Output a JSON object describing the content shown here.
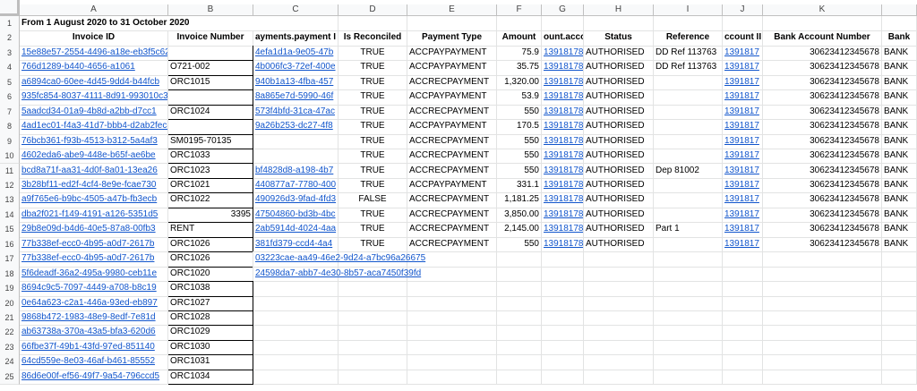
{
  "column_letters": [
    "A",
    "B",
    "C",
    "D",
    "E",
    "F",
    "G",
    "H",
    "I",
    "J",
    "K",
    ""
  ],
  "title": "From 1 August 2020 to 31 October 2020",
  "headers": [
    "Invoice ID",
    "Invoice Number",
    "ayments.payment I",
    "Is Reconciled",
    "Payment Type",
    "Amount",
    "ount.accou",
    "Status",
    "Reference",
    "ccount II",
    "Bank Account Number",
    "Bank"
  ],
  "rows": [
    [
      "15e88e57-2554-4496-a18e-eb3f5c622345",
      "",
      "4efa1d1a-9e05-47b",
      "TRUE",
      "ACCPAYPAYMENT",
      "75.9",
      "13918178",
      "AUTHORISED",
      "DD Ref 113763",
      "1391817",
      "30623412345678",
      "BANK"
    ],
    [
      "766d1289-b440-4656-a1061",
      "O721-002",
      "4b006fc3-72ef-400e",
      "TRUE",
      "ACCPAYPAYMENT",
      "35.75",
      "13918178",
      "AUTHORISED",
      "DD Ref 113763",
      "1391817",
      "30623412345678",
      "BANK"
    ],
    [
      "a6894ca0-60ee-4d45-9dd4-b44fcb",
      "ORC1015",
      "940b1a13-4fba-457",
      "TRUE",
      "ACCRECPAYMENT",
      "1,320.00",
      "13918178",
      "AUTHORISED",
      "",
      "1391817",
      "30623412345678",
      "BANK"
    ],
    [
      "935fc854-8037-4111-8d91-993010c331cc",
      "",
      "8a865e7d-5990-46f",
      "TRUE",
      "ACCPAYPAYMENT",
      "53.9",
      "13918178",
      "AUTHORISED",
      "",
      "1391817",
      "30623412345678",
      "BANK"
    ],
    [
      "5aadcd34-01a9-4b8d-a2bb-d7cc1",
      "ORC1024",
      "573f4bfd-31ca-47ac",
      "TRUE",
      "ACCRECPAYMENT",
      "550",
      "13918178",
      "AUTHORISED",
      "",
      "1391817",
      "30623412345678",
      "BANK"
    ],
    [
      "4ad1ec01-f4a3-41d7-bbb4-d2ab2fec8e65",
      "",
      "9a26b253-dc27-4f8",
      "TRUE",
      "ACCPAYPAYMENT",
      "170.5",
      "13918178",
      "AUTHORISED",
      "",
      "1391817",
      "30623412345678",
      "BANK"
    ],
    [
      "76bcb361-f93b-4513-b312-5a4af3",
      "SM0195-70135",
      "",
      "TRUE",
      "ACCRECPAYMENT",
      "550",
      "13918178",
      "AUTHORISED",
      "",
      "1391817",
      "30623412345678",
      "BANK"
    ],
    [
      "4602eda6-abe9-448e-b65f-ae6be",
      "ORC1033",
      "",
      "TRUE",
      "ACCRECPAYMENT",
      "550",
      "13918178",
      "AUTHORISED",
      "",
      "1391817",
      "30623412345678",
      "BANK"
    ],
    [
      "bcd8a71f-aa31-4d0f-8a01-13ea26",
      "ORC1023",
      "bf4828d8-a198-4b7",
      "TRUE",
      "ACCRECPAYMENT",
      "550",
      "13918178",
      "AUTHORISED",
      "Dep 81002",
      "1391817",
      "30623412345678",
      "BANK"
    ],
    [
      "3b28bf11-ed2f-4cf4-8e9e-fcae730",
      "ORC1021",
      "440877a7-7780-400",
      "TRUE",
      "ACCPAYPAYMENT",
      "331.1",
      "13918178",
      "AUTHORISED",
      "",
      "1391817",
      "30623412345678",
      "BANK"
    ],
    [
      "a9f765e6-b9bc-4505-a47b-fb3ecb",
      "ORC1022",
      "490926d3-9fad-4fd3",
      "FALSE",
      "ACCRECPAYMENT",
      "1,181.25",
      "13918178",
      "AUTHORISED",
      "",
      "1391817",
      "30623412345678",
      "BANK"
    ],
    [
      "dba2f021-f149-4191-a126-5351d5",
      "3395",
      "47504860-bd3b-4bc",
      "TRUE",
      "ACCRECPAYMENT",
      "3,850.00",
      "13918178",
      "AUTHORISED",
      "",
      "1391817",
      "30623412345678",
      "BANK"
    ],
    [
      "29b8e09d-b4d6-40e5-87a8-00fb3",
      "RENT",
      "2ab5914d-4024-4aa",
      "TRUE",
      "ACCRECPAYMENT",
      "2,145.00",
      "13918178",
      "AUTHORISED",
      "Part 1",
      "1391817",
      "30623412345678",
      "BANK"
    ],
    [
      "77b338ef-ecc0-4b95-a0d7-2617b",
      "ORC1026",
      "381fd379-ccd4-4a4",
      "TRUE",
      "ACCRECPAYMENT",
      "550",
      "13918178",
      "AUTHORISED",
      "",
      "1391817",
      "30623412345678",
      "BANK"
    ],
    [
      "77b338ef-ecc0-4b95-a0d7-2617b",
      "ORC1026",
      "03223cae-aa49-46e2-9d24-a7bc96a26675",
      "",
      "",
      "",
      "",
      "",
      "",
      "",
      "",
      ""
    ],
    [
      "5f6deadf-36a2-495a-9980-ceb11e",
      "ORC1020",
      "24598da7-abb7-4e30-8b57-aca7450f39fd",
      "",
      "",
      "",
      "",
      "",
      "",
      "",
      "",
      ""
    ],
    [
      "8694c9c5-7097-4449-a708-b8c19",
      "ORC1038",
      "",
      "",
      "",
      "",
      "",
      "",
      "",
      "",
      "",
      ""
    ],
    [
      "0e64a623-c2a1-446a-93ed-eb897",
      "ORC1027",
      "",
      "",
      "",
      "",
      "",
      "",
      "",
      "",
      "",
      ""
    ],
    [
      "9868b472-1983-48e9-8edf-7e81d",
      "ORC1028",
      "",
      "",
      "",
      "",
      "",
      "",
      "",
      "",
      "",
      ""
    ],
    [
      "ab63738a-370a-43a5-bfa3-620d6",
      "ORC1029",
      "",
      "",
      "",
      "",
      "",
      "",
      "",
      "",
      "",
      ""
    ],
    [
      "66fbe37f-49b1-43fd-97ed-851140",
      "ORC1030",
      "",
      "",
      "",
      "",
      "",
      "",
      "",
      "",
      "",
      ""
    ],
    [
      "64cd559e-8e03-46af-b461-85552",
      "ORC1031",
      "",
      "",
      "",
      "",
      "",
      "",
      "",
      "",
      "",
      ""
    ],
    [
      "86d6e00f-ef56-49f7-9a54-796ccd5",
      "ORC1034",
      "",
      "",
      "",
      "",
      "",
      "",
      "",
      "",
      "",
      ""
    ]
  ]
}
